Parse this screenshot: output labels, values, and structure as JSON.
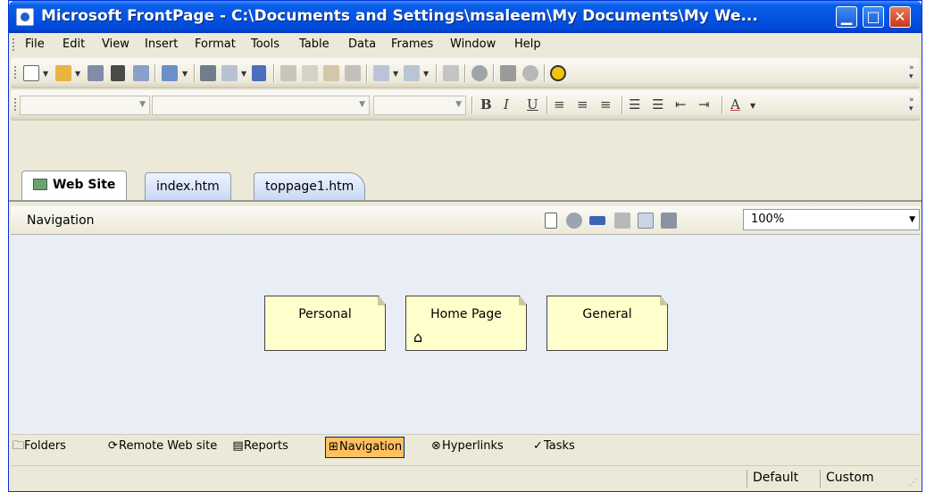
{
  "window": {
    "title": "Microsoft FrontPage - C:\\Documents and Settings\\msaleem\\My Documents\\My We...",
    "minimize_glyph": "▁",
    "maximize_glyph": "□",
    "close_glyph": "✕"
  },
  "menubar": {
    "items": [
      {
        "label": "File"
      },
      {
        "label": "Edit"
      },
      {
        "label": "View"
      },
      {
        "label": "Insert"
      },
      {
        "label": "Format"
      },
      {
        "label": "Tools"
      },
      {
        "label": "Table"
      },
      {
        "label": "Data"
      },
      {
        "label": "Frames"
      },
      {
        "label": "Window"
      },
      {
        "label": "Help"
      }
    ]
  },
  "standard_toolbar": {
    "icons": [
      "new-page-icon",
      "open-icon",
      "save-icon",
      "find-icon",
      "publish-icon",
      "web-component-icon",
      "print-icon",
      "preview-icon",
      "spelling-icon",
      "cut-icon",
      "copy-icon",
      "paste-icon",
      "format-painter-icon",
      "undo-icon",
      "redo-icon",
      "insert-table-icon",
      "insert-picture-icon",
      "refresh-icon",
      "stop-icon",
      "help-icon"
    ]
  },
  "formatting_toolbar": {
    "style_combo": "",
    "font_combo": "",
    "size_combo": "",
    "bold": "B",
    "italic": "I",
    "underline": "U",
    "font_color": "A"
  },
  "tabs": [
    {
      "label": "Web Site",
      "active": true
    },
    {
      "label": "index.htm",
      "active": false
    },
    {
      "label": "toppage1.htm",
      "active": false
    }
  ],
  "viewbar": {
    "label": "Navigation",
    "zoom": "100%"
  },
  "navigation_nodes": [
    {
      "label": "Personal",
      "home": false
    },
    {
      "label": "Home Page",
      "home": true
    },
    {
      "label": "General",
      "home": false
    }
  ],
  "view_switcher": [
    {
      "label": "Folders",
      "icon": "folder-icon",
      "active": false
    },
    {
      "label": "Remote Web site",
      "icon": "remote-site-icon",
      "active": false
    },
    {
      "label": "Reports",
      "icon": "reports-icon",
      "active": false
    },
    {
      "label": "Navigation",
      "icon": "navigation-icon",
      "active": true
    },
    {
      "label": "Hyperlinks",
      "icon": "hyperlinks-icon",
      "active": false
    },
    {
      "label": "Tasks",
      "icon": "tasks-icon",
      "active": false
    }
  ],
  "statusbar": {
    "mode": "Default",
    "size": "Custom"
  },
  "colors": {
    "titlebar": "#0554e3",
    "canvas": "#e9eef6",
    "node_fill": "#ffffcc",
    "active_view": "#ffc060"
  }
}
